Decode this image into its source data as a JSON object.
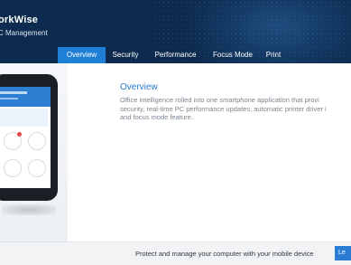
{
  "app": {
    "title": "orkWise",
    "subtitle": "C Management"
  },
  "tabs": [
    {
      "label": "Overview",
      "active": true
    },
    {
      "label": "Security",
      "active": false
    },
    {
      "label": "Performance",
      "active": false
    },
    {
      "label": "Focus Mode",
      "active": false
    },
    {
      "label": "Print",
      "active": false
    }
  ],
  "content": {
    "title": "Overview",
    "lines": [
      "Office intelligence rolled into one smartphone application that provi",
      "security, real-time PC performance updates, automatic printer driver i",
      "and focus mode feature."
    ]
  },
  "footer": {
    "text": "Protect and manage your computer with your mobile device",
    "button_label": "Le"
  },
  "colors": {
    "header_bg": "#0d2b4e",
    "accent": "#1f7fd6",
    "title_blue": "#2a7dd2"
  }
}
